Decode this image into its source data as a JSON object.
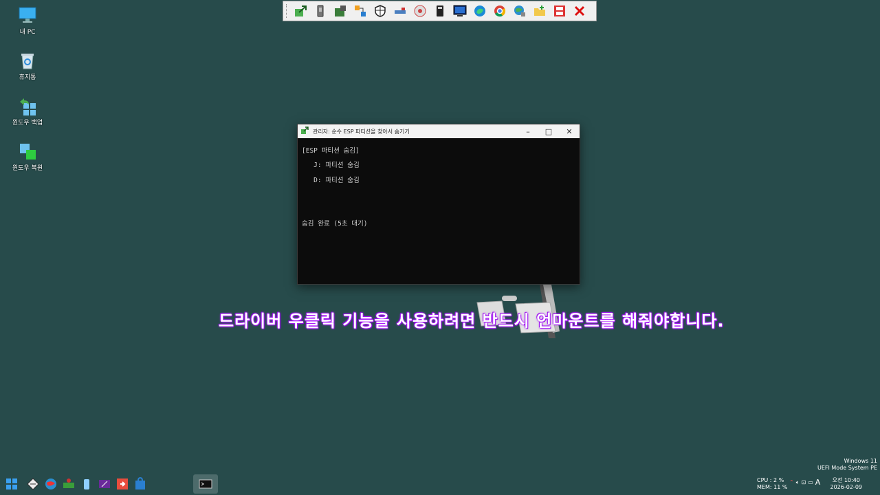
{
  "desktop": {
    "icons": [
      {
        "label": "내 PC"
      },
      {
        "label": "휴지통"
      },
      {
        "label": "윈도우 백업"
      },
      {
        "label": "윈도우 복원"
      }
    ]
  },
  "toolbar": {
    "icons": [
      "share-icon",
      "usb-drive-icon",
      "hardware-icon",
      "network-share-icon",
      "shield-icon",
      "network-icon",
      "disk-icon",
      "memory-card-icon",
      "monitor-icon",
      "edge-icon",
      "chrome-icon",
      "globe-icon",
      "folder-add-icon",
      "film-icon",
      "close-icon"
    ]
  },
  "window": {
    "title": "관리자:  순수 ESP 파티션을 찾아서 숨기기",
    "minimize": "–",
    "maximize": "□",
    "close": "✕",
    "lines": [
      "[ESP 파티션 숨김]",
      "   J: 파티션 숨김",
      "   D: 파티션 숨김",
      "",
      "",
      "숨김 완료 (5초 대기)"
    ]
  },
  "caption": "드라이버 우클릭 기능을 사용하려면 반드시 언마운트를 해줘야합니다.",
  "os_info": {
    "line1": "Windows 11",
    "line2": "UEFI Mode System PE"
  },
  "tray": {
    "cpu": "CPU :   2 %",
    "mem": "MEM:  11 %",
    "time": "오전 10:40",
    "date": "2026-02-09",
    "ime": "A"
  },
  "colors": {
    "desktop_bg": "#274b4b",
    "caption_glow": "#b020ff"
  }
}
